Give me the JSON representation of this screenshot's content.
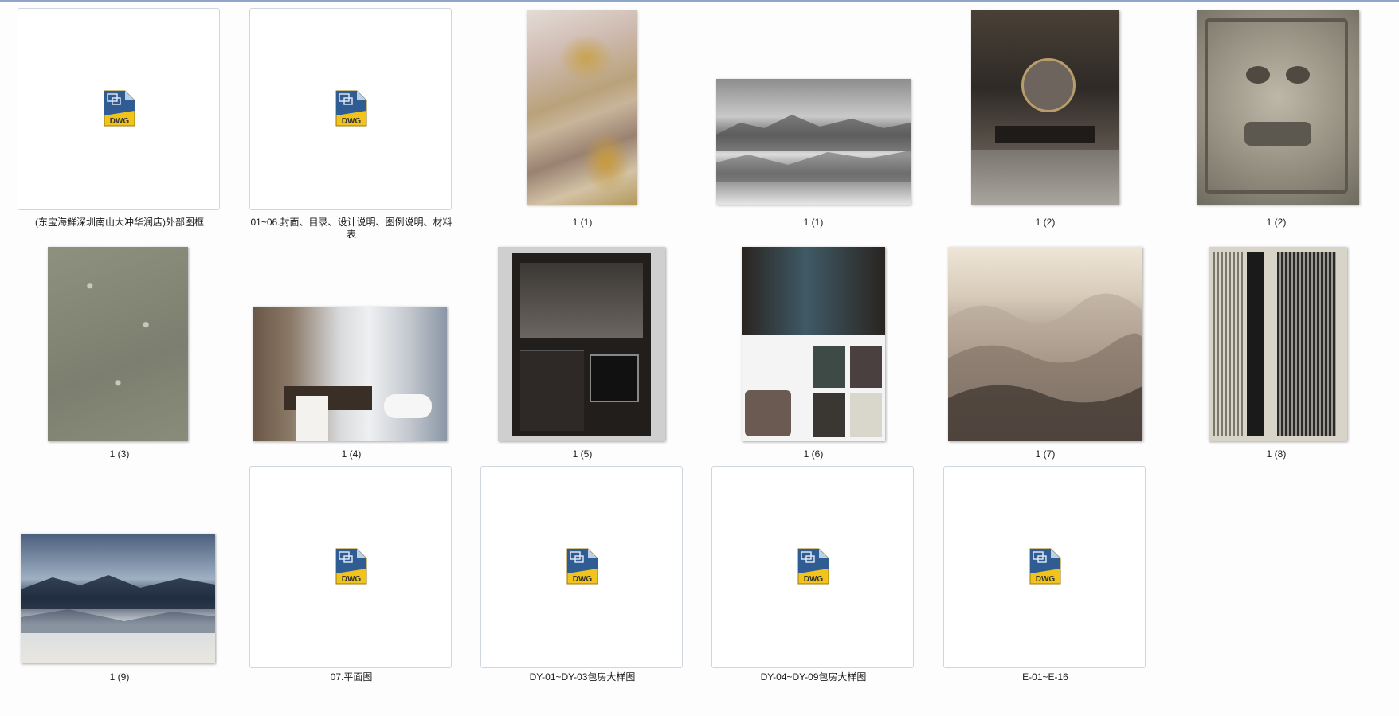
{
  "file_view": {
    "rows": [
      {
        "items": [
          {
            "label": "(东宝海鲜深圳南山大冲华润店)外部图框",
            "kind": "dwg",
            "icon": "dwg-file-icon",
            "badge": "DWG"
          },
          {
            "label": "01~06.封面、目录、设计说明、图例说明、材料表",
            "kind": "dwg",
            "icon": "dwg-file-icon",
            "badge": "DWG"
          },
          {
            "label": "1 (1)",
            "kind": "image",
            "subject": "abstract-gold-painting"
          },
          {
            "label": "1 (1)",
            "kind": "image",
            "subject": "misty-mountains-grey"
          },
          {
            "label": "1 (2)",
            "kind": "image",
            "subject": "bathroom-mirror"
          },
          {
            "label": "1 (2)",
            "kind": "image",
            "subject": "stone-relief-face"
          }
        ]
      },
      {
        "items": [
          {
            "label": "1 (3)",
            "kind": "image",
            "subject": "floral-wallpaper"
          },
          {
            "label": "1 (4)",
            "kind": "image",
            "subject": "modern-bathroom"
          },
          {
            "label": "1 (5)",
            "kind": "image",
            "subject": "bar-cabinet"
          },
          {
            "label": "1 (6)",
            "kind": "image",
            "subject": "luxury-moodboard"
          },
          {
            "label": "1 (7)",
            "kind": "image",
            "subject": "layered-mountain-gradient"
          },
          {
            "label": "1 (8)",
            "kind": "image",
            "subject": "ink-brush-strokes"
          }
        ]
      },
      {
        "items": [
          {
            "label": "1 (9)",
            "kind": "image",
            "subject": "blue-mountains-fog"
          },
          {
            "label": "07.平面图",
            "kind": "dwg",
            "icon": "dwg-file-icon",
            "badge": "DWG"
          },
          {
            "label": "DY-01~DY-03包房大样图",
            "kind": "dwg",
            "icon": "dwg-file-icon",
            "badge": "DWG"
          },
          {
            "label": "DY-04~DY-09包房大样图",
            "kind": "dwg",
            "icon": "dwg-file-icon",
            "badge": "DWG"
          },
          {
            "label": "E-01~E-16",
            "kind": "dwg",
            "icon": "dwg-file-icon",
            "badge": "DWG"
          }
        ]
      }
    ],
    "colors": {
      "frame_border": "#cfd6de",
      "background": "#fdfdfd",
      "dwg_blue": "#2f5c93",
      "dwg_yellow": "#f2c31a"
    }
  }
}
